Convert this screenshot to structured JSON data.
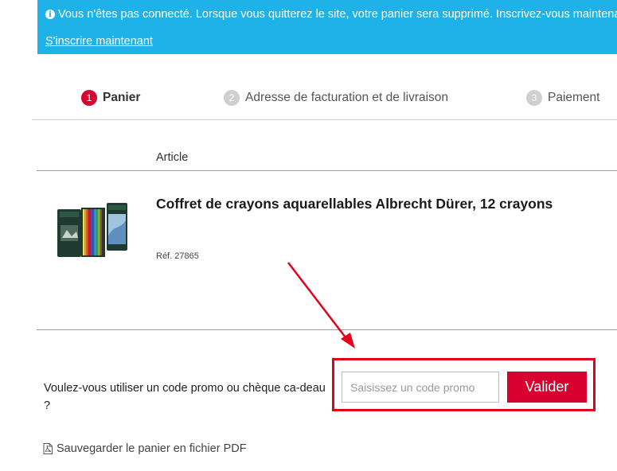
{
  "banner": {
    "icon": "info-icon",
    "message": "Vous n'êtes pas connecté. Lorsque vous quitterez le site, votre panier sera supprimé. Inscrivez-vous maintenant",
    "link": "S'inscrire maintenant",
    "color": "#1fb2e8"
  },
  "steps": [
    {
      "number": "1",
      "label": "Panier",
      "active": true
    },
    {
      "number": "2",
      "label": "Adresse de facturation et de livraison",
      "active": false
    },
    {
      "number": "3",
      "label": "Paiement",
      "active": false
    }
  ],
  "cart": {
    "column_header": "Article",
    "item": {
      "title": "Coffret de crayons aquarellables Albrecht Dürer, 12 crayons",
      "ref": "Réf. 27865",
      "image": "pencil-set-product-image"
    }
  },
  "promo": {
    "question": "Voulez-vous utiliser un code promo ou chèque ca-deau ?",
    "placeholder": "Saisissez un code promo",
    "value": "",
    "button": "Valider"
  },
  "pdf": {
    "icon": "pdf-file-icon",
    "label": "Sauvegarder le panier en fichier PDF"
  },
  "colors": {
    "accent": "#d8002f",
    "annotation": "#e3001b",
    "step_inactive": "#cfcfcf"
  }
}
